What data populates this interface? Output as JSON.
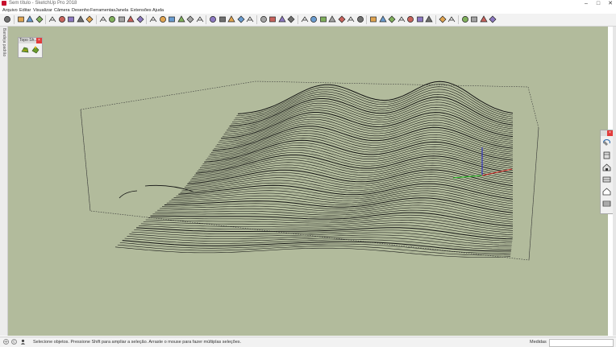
{
  "window": {
    "title": "Sem título - SketchUp Pro 2018",
    "minimize": "–",
    "maximize": "□",
    "close": "✕"
  },
  "menu": [
    "Arquivo",
    "Editar",
    "Visualizar",
    "Câmera",
    "Desenho",
    "Ferramentas",
    "Janela",
    "Extensões",
    "Ajuda"
  ],
  "toolbar": {
    "icons": [
      "select-icon",
      "eraser-icon",
      "paint-bucket-icon",
      "component-icon",
      "rectangle-icon",
      "line-icon",
      "circle-icon",
      "arc-icon",
      "polygon-icon",
      "push-pull-icon",
      "move-icon",
      "rotate-icon",
      "scale-icon",
      "offset-icon",
      "tape-measure-icon",
      "dimension-icon",
      "protractor-icon",
      "text-icon",
      "axes-icon",
      "3d-text-icon",
      "orbit-icon",
      "pan-icon",
      "zoom-icon",
      "zoom-window-icon",
      "zoom-extents-icon",
      "position-camera-icon",
      "walk-icon",
      "look-around-icon",
      "section-plane-icon",
      "iso-view-icon",
      "top-view-icon",
      "front-view-icon",
      "right-view-icon",
      "back-view-icon",
      "left-view-icon",
      "bottom-view-icon",
      "xray-icon",
      "back-edges-icon",
      "wireframe-icon",
      "hidden-line-icon",
      "shaded-icon",
      "textured-icon",
      "monochrome-icon",
      "styles-icon",
      "layers-icon",
      "warehouse-icon",
      "extension-warehouse-icon",
      "sketchup-account-icon",
      "help-icon"
    ]
  },
  "left_panel": {
    "label": "Bandeja padrão"
  },
  "sandbox_toolbar": {
    "title": "Topo Sh...",
    "close": "×",
    "buttons": [
      "sandbox-from-contours-icon",
      "sandbox-from-scratch-icon"
    ]
  },
  "views_toolbar": {
    "buttons": [
      "orbit-small-icon",
      "front-view-icon",
      "top-view-icon",
      "right-view-icon",
      "house-view-icon",
      "back-view-icon"
    ]
  },
  "status": {
    "message": "Selecione objetos. Pressione Shift para ampliar a seleção. Arraste o mouse para fazer múltiplas seleções.",
    "measure_label": "Medidas",
    "measure_value": ""
  },
  "colors": {
    "viewport_bg": "#b2bb9c",
    "contour": "#111111",
    "axis_red": "#cc2222",
    "axis_green": "#22bb22",
    "axis_blue": "#2222cc"
  }
}
